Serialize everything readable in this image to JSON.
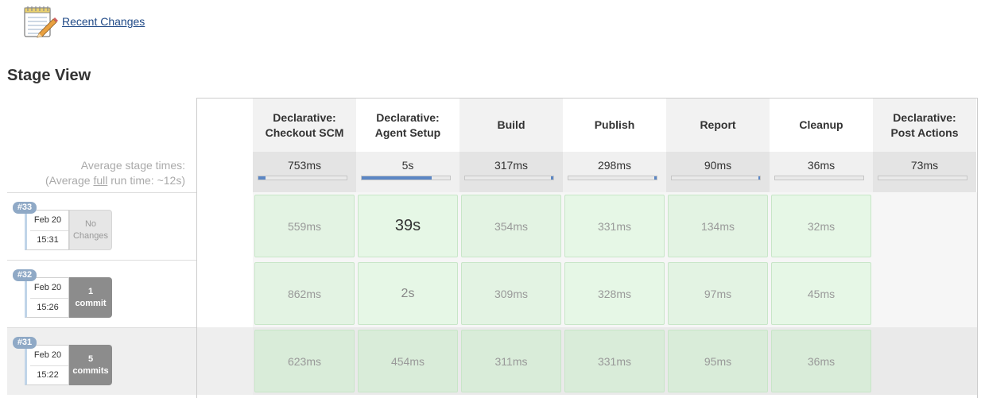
{
  "header": {
    "recent_changes": "Recent Changes"
  },
  "title": "Stage View",
  "avg": {
    "line1": "Average stage times:",
    "line2_pre": "(Average ",
    "line2_full": "full",
    "line2_post": " run time: ~12s)"
  },
  "stages": [
    {
      "line1": "Declarative:",
      "line2": "Checkout SCM",
      "avg": "753ms",
      "fill": 0.08,
      "fill_pos": "left"
    },
    {
      "line1": "Declarative:",
      "line2": "Agent Setup",
      "avg": "5s",
      "fill": 0.79,
      "fill_pos": "left"
    },
    {
      "line1": "Build",
      "line2": "",
      "avg": "317ms",
      "fill": 0.03,
      "fill_pos": "right"
    },
    {
      "line1": "Publish",
      "line2": "",
      "avg": "298ms",
      "fill": 0.03,
      "fill_pos": "right"
    },
    {
      "line1": "Report",
      "line2": "",
      "avg": "90ms",
      "fill": 0.01,
      "fill_pos": "right"
    },
    {
      "line1": "Cleanup",
      "line2": "",
      "avg": "36ms",
      "fill": 0,
      "fill_pos": "right"
    },
    {
      "line1": "Declarative:",
      "line2": "Post Actions",
      "avg": "73ms",
      "fill": 0,
      "fill_pos": "right"
    }
  ],
  "builds": [
    {
      "num": "#33",
      "date": "Feb 20",
      "time": "15:31",
      "changes_l1": "No",
      "changes_l2": "Changes",
      "has_changes": false,
      "times": [
        "559ms",
        "39s",
        "354ms",
        "331ms",
        "134ms",
        "32ms"
      ]
    },
    {
      "num": "#32",
      "date": "Feb 20",
      "time": "15:26",
      "changes_l1": "1",
      "changes_l2": "commit",
      "has_changes": true,
      "times": [
        "862ms",
        "2s",
        "309ms",
        "328ms",
        "97ms",
        "45ms"
      ]
    },
    {
      "num": "#31",
      "date": "Feb 20",
      "time": "15:22",
      "changes_l1": "5",
      "changes_l2": "commits",
      "has_changes": true,
      "times": [
        "623ms",
        "454ms",
        "311ms",
        "331ms",
        "95ms",
        "36ms"
      ]
    }
  ],
  "colors": {
    "cell_even": "#e3f3e3",
    "cell_odd": "#e6f7e6",
    "cell_alt": "#d9ecd9",
    "bar_fill": "#5b86c4"
  }
}
